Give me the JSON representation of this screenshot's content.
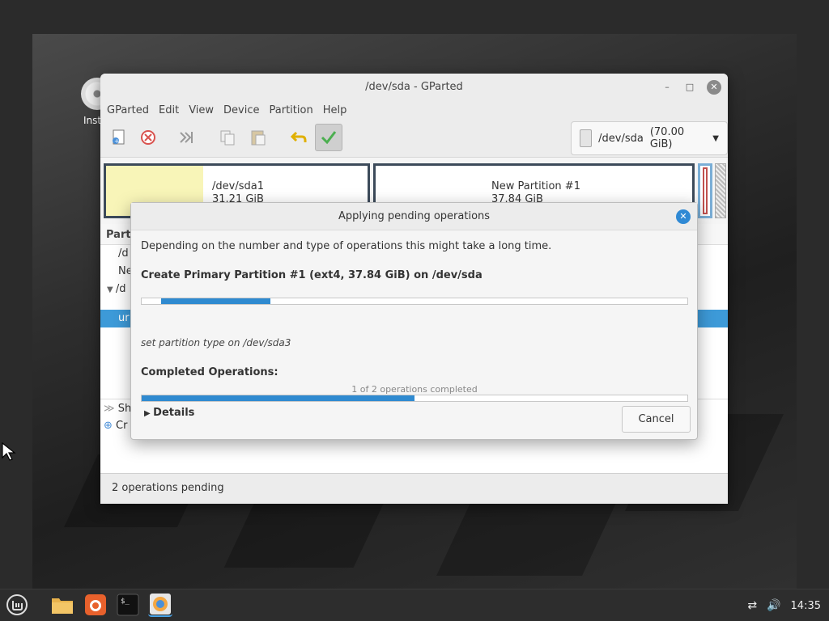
{
  "desktop": {
    "icon_label": "Inst"
  },
  "window": {
    "title": "/dev/sda - GParted",
    "menu": [
      "GParted",
      "Edit",
      "View",
      "Device",
      "Partition",
      "Help"
    ],
    "toolbar": {
      "icons": [
        "new-partition-icon",
        "delete-icon",
        "resize-move-icon",
        "copy-icon",
        "paste-icon",
        "undo-icon",
        "apply-icon"
      ]
    },
    "device_select": {
      "device": "/dev/sda",
      "size": "(70.00 GiB)"
    },
    "partitions": [
      {
        "name": "/dev/sda1",
        "size": "31.21 GiB"
      },
      {
        "name": "New Partition #1",
        "size": "37.84 GiB"
      }
    ],
    "list": {
      "header": "Parti",
      "rows": [
        "/d",
        "Ne",
        "/d",
        "ur"
      ]
    },
    "ops_rows": [
      "Sh",
      "Cr"
    ],
    "status": "2 operations pending"
  },
  "dialog": {
    "title": "Applying pending operations",
    "description": "Depending on the number and type of operations this might take a long time.",
    "operation": "Create Primary Partition #1 (ext4, 37.84 GiB) on /dev/sda",
    "operation_progress": 0.2,
    "sub_status": "set partition type on /dev/sda3",
    "completed_title": "Completed Operations:",
    "completed_count": "1 of 2 operations completed",
    "completed_progress": 0.5,
    "details_label": "Details",
    "cancel_label": "Cancel"
  },
  "taskbar": {
    "apps": [
      "mint-menu-icon",
      "files-icon",
      "firefox-icon",
      "terminal-icon",
      "gparted-icon"
    ],
    "time": "14:35"
  },
  "colors": {
    "accent": "#2f8ad0",
    "selection": "#3d9ad8",
    "partition_fill": "#f8f5b8"
  }
}
